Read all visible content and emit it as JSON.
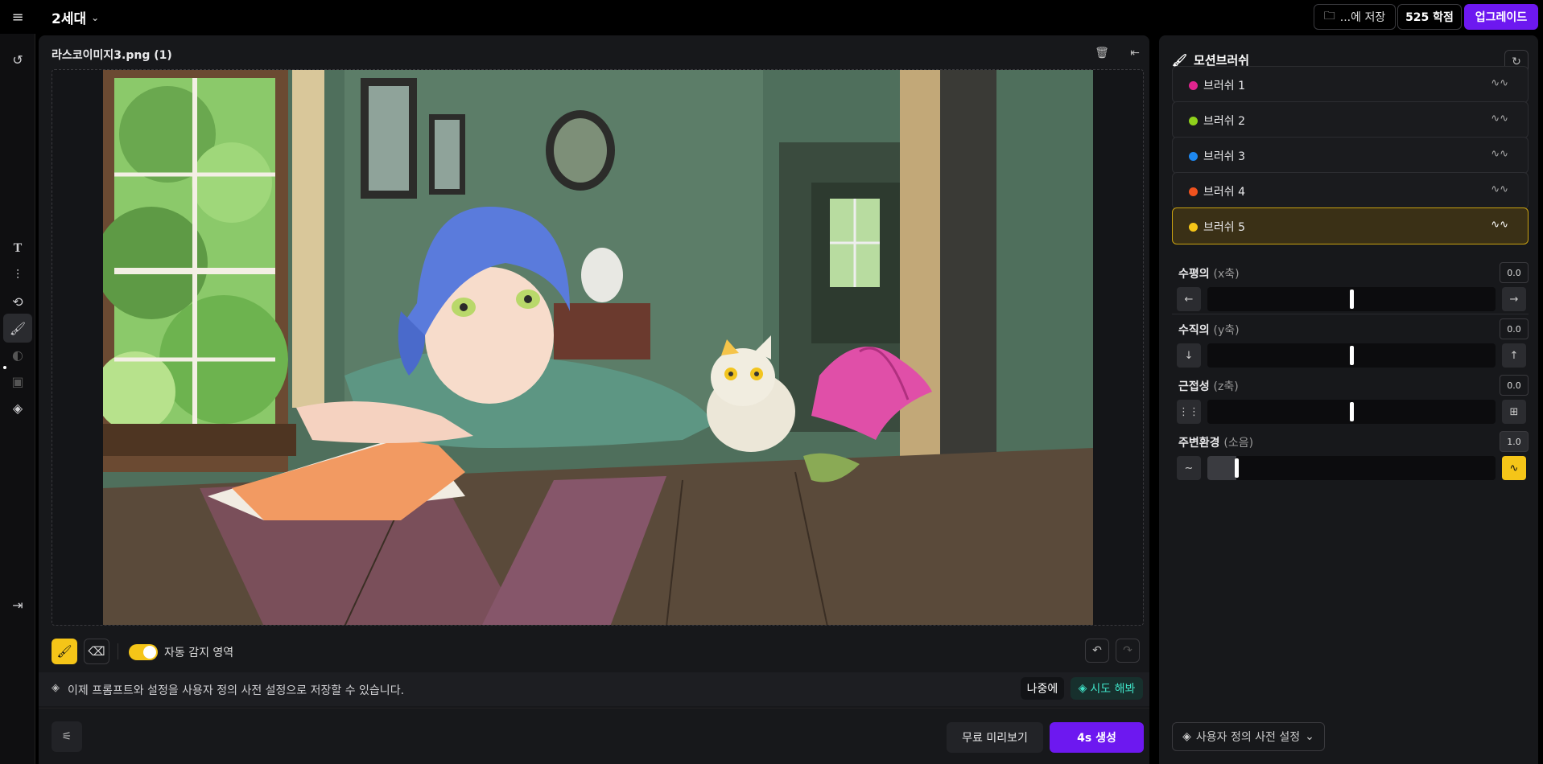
{
  "topbar": {
    "project_name": "2세대",
    "save_label": "...에 저장",
    "credits_label": "525 학점",
    "upgrade_label": "업그레이드"
  },
  "editor": {
    "file_name": "라스코이미지3.png (1)",
    "auto_detect_label": "자동 감지 영역",
    "auto_detect_on": true
  },
  "notice": {
    "text": "이제 프롬프트와 설정을 사용자 정의 사전 설정으로 저장할 수 있습니다.",
    "later_label": "나중에",
    "try_label": "시도 해봐"
  },
  "actions": {
    "preview_label": "무료 미리보기",
    "generate_label": "4s 생성"
  },
  "panel": {
    "title": "모션브러쉬",
    "brushes": [
      {
        "label": "브러쉬 1",
        "color": "#e0248f"
      },
      {
        "label": "브러쉬 2",
        "color": "#8fd11b"
      },
      {
        "label": "브러쉬 3",
        "color": "#1e88f0"
      },
      {
        "label": "브러쉬 4",
        "color": "#f0521e"
      },
      {
        "label": "브러쉬 5",
        "color": "#f5c518",
        "selected": true
      }
    ],
    "axes": [
      {
        "label": "수평의",
        "sub": "(x축)",
        "value": "0.0",
        "level": 0.5
      },
      {
        "label": "수직의",
        "sub": "(y축)",
        "value": "0.0",
        "level": 0.5
      },
      {
        "label": "근접성",
        "sub": "(z축)",
        "value": "0.0",
        "level": 0.5
      },
      {
        "label": "주변환경",
        "sub": "(소음)",
        "value": "1.0",
        "level": 0.1
      }
    ],
    "preset_label": "사용자 정의 사전 설정"
  },
  "colors": {
    "accent_purple": "#6d18f0",
    "accent_yellow": "#f5c518",
    "teal": "#3fe0c5"
  }
}
